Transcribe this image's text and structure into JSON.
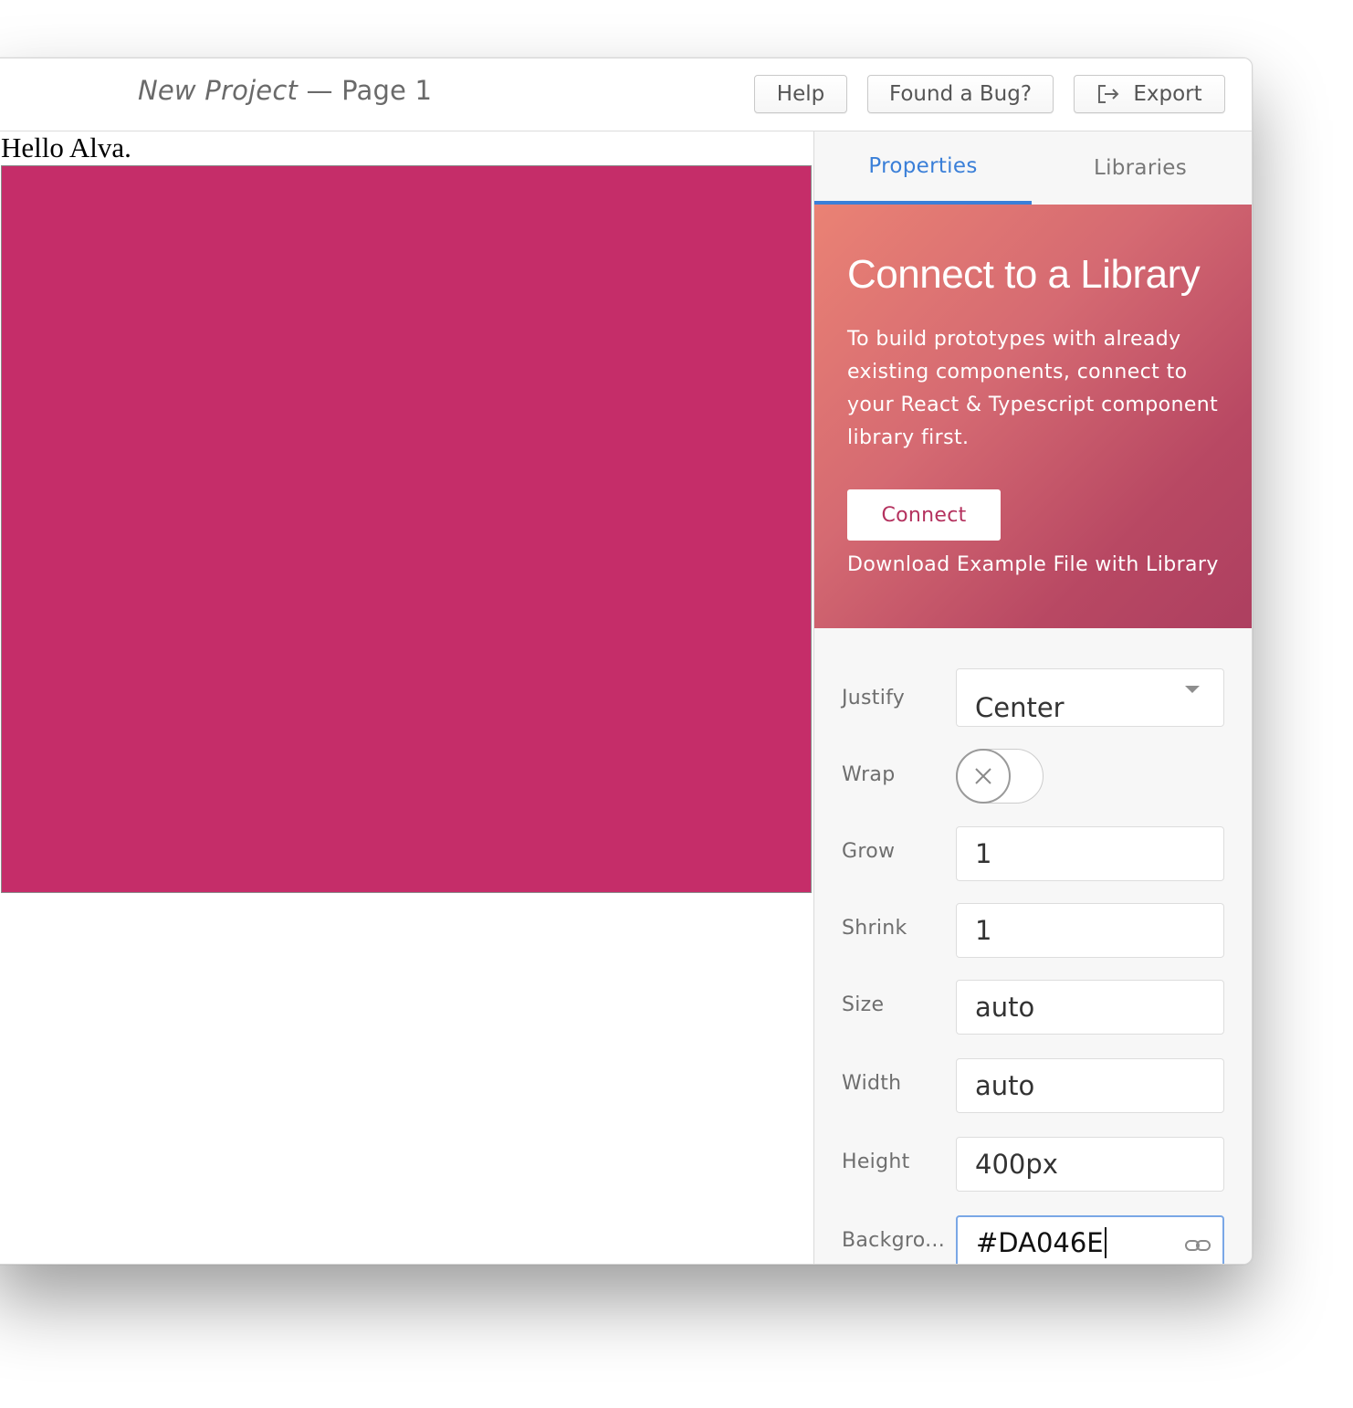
{
  "titlebar": {
    "project": "New Project",
    "separator": " — ",
    "page": "Page 1",
    "buttons": {
      "help": "Help",
      "bug": "Found a Bug?",
      "export": "Export"
    }
  },
  "canvas": {
    "heading": "Hello Alva.",
    "box_color": "#C52D69"
  },
  "sidebar": {
    "tabs": [
      {
        "label": "Properties",
        "active": true
      },
      {
        "label": "Libraries",
        "active": false
      }
    ],
    "banner": {
      "title": "Connect to a Library",
      "text": "To build prototypes with already existing components, connect to your React & Typescript component library first.",
      "connect_label": "Connect",
      "download_label": "Download Example File with Library"
    },
    "properties": {
      "justify": {
        "label": "Justify",
        "value": "Center"
      },
      "wrap": {
        "label": "Wrap",
        "value": false
      },
      "grow": {
        "label": "Grow",
        "value": "1"
      },
      "shrink": {
        "label": "Shrink",
        "value": "1"
      },
      "size": {
        "label": "Size",
        "value": "auto"
      },
      "width": {
        "label": "Width",
        "value": "auto"
      },
      "height": {
        "label": "Height",
        "value": "400px"
      },
      "background": {
        "label": "Backgro...",
        "value": "#DA046E"
      }
    }
  },
  "colors": {
    "accent": "#3A7FD8",
    "banner_start": "#EA8274",
    "banner_end": "#AD3F60"
  },
  "icons": [
    "export-icon",
    "chevron-down-icon",
    "close-icon",
    "link-icon"
  ]
}
